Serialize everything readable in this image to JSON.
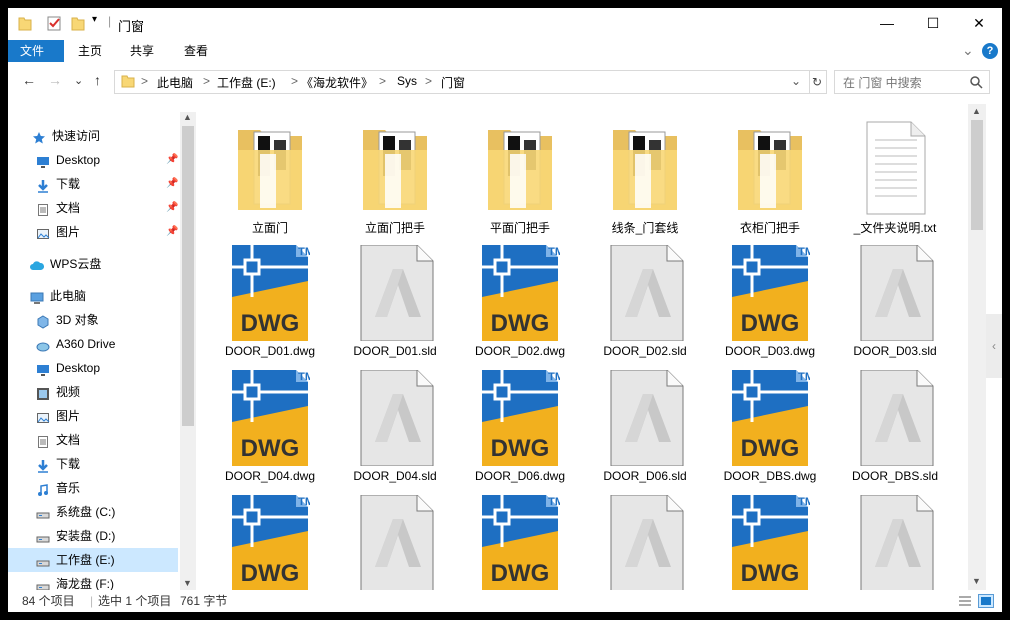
{
  "window": {
    "title": "门窗",
    "minimize_glyph": "—",
    "maximize_glyph": "☐",
    "close_glyph": "✕"
  },
  "ribbon": {
    "tabs": [
      "文件",
      "主页",
      "共享",
      "查看"
    ],
    "expand_glyph": "⌄",
    "help_glyph": "?"
  },
  "address": {
    "back_glyph": "←",
    "forward_glyph": "→",
    "recent_glyph": "⌄",
    "up_glyph": "↑",
    "crumbs": [
      "此电脑",
      "工作盘 (E:)",
      "《海龙软件》",
      "Sys",
      "门窗"
    ],
    "separator": ">",
    "dropdown_glyph": "⌄",
    "refresh_glyph": "↻",
    "search_placeholder": "在 门窗 中搜索"
  },
  "sidebar": {
    "items": [
      {
        "label": "快速访问",
        "icon": "star-icon",
        "pinned": false
      },
      {
        "label": "Desktop",
        "icon": "desktop-icon",
        "pinned": true
      },
      {
        "label": "下载",
        "icon": "download-icon",
        "pinned": true
      },
      {
        "label": "文档",
        "icon": "document-icon",
        "pinned": true
      },
      {
        "label": "图片",
        "icon": "picture-icon",
        "pinned": true
      },
      {
        "label": "WPS云盘",
        "icon": "cloud-icon",
        "pinned": false
      },
      {
        "label": "此电脑",
        "icon": "computer-icon",
        "pinned": false
      },
      {
        "label": "3D 对象",
        "icon": "3d-object-icon",
        "pinned": false
      },
      {
        "label": "A360 Drive",
        "icon": "a360-icon",
        "pinned": false
      },
      {
        "label": "Desktop",
        "icon": "desktop-icon",
        "pinned": false
      },
      {
        "label": "视频",
        "icon": "video-icon",
        "pinned": false
      },
      {
        "label": "图片",
        "icon": "picture-icon",
        "pinned": false
      },
      {
        "label": "文档",
        "icon": "document-icon",
        "pinned": false
      },
      {
        "label": "下载",
        "icon": "download-icon",
        "pinned": false
      },
      {
        "label": "音乐",
        "icon": "music-icon",
        "pinned": false
      },
      {
        "label": "系统盘 (C:)",
        "icon": "drive-icon",
        "pinned": false
      },
      {
        "label": "安装盘 (D:)",
        "icon": "drive-icon",
        "pinned": false
      },
      {
        "label": "工作盘 (E:)",
        "icon": "drive-icon",
        "pinned": false,
        "selected": true
      },
      {
        "label": "海龙盘 (F:)",
        "icon": "drive-icon",
        "pinned": false
      }
    ]
  },
  "files": [
    {
      "name": "立面门",
      "type": "folder"
    },
    {
      "name": "立面门把手",
      "type": "folder"
    },
    {
      "name": "平面门把手",
      "type": "folder"
    },
    {
      "name": "线条_门套线",
      "type": "folder"
    },
    {
      "name": "衣柜门把手",
      "type": "folder"
    },
    {
      "name": "_文件夹说明.txt",
      "type": "txt"
    },
    {
      "name": "DOOR_D01.dwg",
      "type": "dwg"
    },
    {
      "name": "DOOR_D01.sld",
      "type": "sld"
    },
    {
      "name": "DOOR_D02.dwg",
      "type": "dwg"
    },
    {
      "name": "DOOR_D02.sld",
      "type": "sld"
    },
    {
      "name": "DOOR_D03.dwg",
      "type": "dwg"
    },
    {
      "name": "DOOR_D03.sld",
      "type": "sld"
    },
    {
      "name": "DOOR_D04.dwg",
      "type": "dwg"
    },
    {
      "name": "DOOR_D04.sld",
      "type": "sld"
    },
    {
      "name": "DOOR_D06.dwg",
      "type": "dwg"
    },
    {
      "name": "DOOR_D06.sld",
      "type": "sld"
    },
    {
      "name": "DOOR_DBS.dwg",
      "type": "dwg"
    },
    {
      "name": "DOOR_DBS.sld",
      "type": "sld"
    },
    {
      "name": "",
      "type": "dwg"
    },
    {
      "name": "",
      "type": "sld"
    },
    {
      "name": "",
      "type": "dwg"
    },
    {
      "name": "",
      "type": "sld"
    },
    {
      "name": "",
      "type": "dwg"
    },
    {
      "name": "",
      "type": "sld"
    }
  ],
  "dwg_badge": {
    "text": "DWG",
    "tm": "TM"
  },
  "status": {
    "count": "84 个项目",
    "selection": "选中 1 个项目",
    "size": "761 字节"
  },
  "colors": {
    "accent": "#1979ca",
    "folder": "#f8d775",
    "dwg_blue": "#1e6fc2",
    "dwg_yellow": "#f2b01e",
    "selection": "#cce8ff"
  }
}
